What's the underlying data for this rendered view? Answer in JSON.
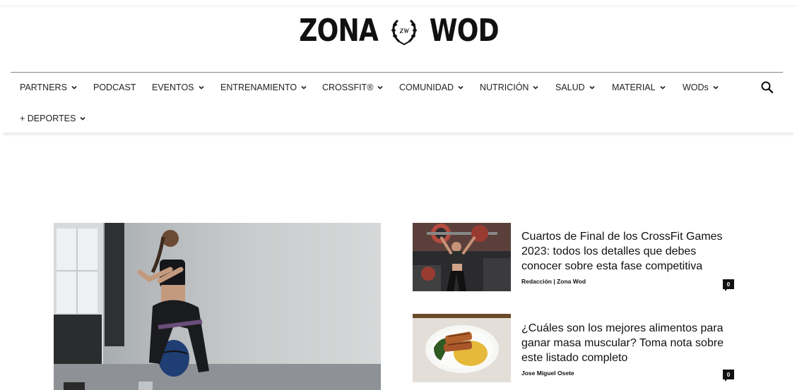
{
  "logo": {
    "left_text": "ZONA",
    "emblem_text": "ZW",
    "right_text": "WOD"
  },
  "nav": {
    "items": [
      {
        "label": "PARTNERS",
        "dropdown": true
      },
      {
        "label": "PODCAST",
        "dropdown": false
      },
      {
        "label": "EVENTOS",
        "dropdown": true
      },
      {
        "label": "ENTRENAMIENTO",
        "dropdown": true
      },
      {
        "label": "CROSSFIT®",
        "dropdown": true
      },
      {
        "label": "COMUNIDAD",
        "dropdown": true
      },
      {
        "label": "NUTRICIÓN",
        "dropdown": true
      },
      {
        "label": "SALUD",
        "dropdown": true
      },
      {
        "label": "MATERIAL",
        "dropdown": true
      },
      {
        "label": "WODs",
        "dropdown": true
      },
      {
        "label": "+ DEPORTES",
        "dropdown": true
      }
    ],
    "search_icon": "search-icon"
  },
  "articles": [
    {
      "title": "Cuartos de Final de los CrossFit Games 2023: todos los detalles que debes conocer sobre esta fase competitiva",
      "author": "Redacción | Zona Wod",
      "comments": "0"
    },
    {
      "title": "¿Cuáles son los mejores alimentos para ganar masa muscular? Toma nota sobre este listado completo",
      "author": "Jose Miguel Osete",
      "comments": "0"
    }
  ]
}
